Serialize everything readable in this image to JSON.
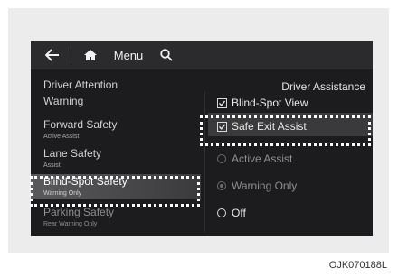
{
  "topbar": {
    "menu_label": "Menu"
  },
  "panel_title": "Driver Assistance",
  "left_menu": [
    {
      "title": "Driver Attention",
      "subtitle": ""
    },
    {
      "title": "Warning",
      "subtitle": ""
    },
    {
      "title": "Forward Safety",
      "subtitle": "Active Assist"
    },
    {
      "title": "Lane Safety",
      "subtitle": "Assist"
    },
    {
      "title": "Blind-Spot Safety",
      "subtitle": "Warning Only"
    },
    {
      "title": "Parking Safety",
      "subtitle": "Rear Warning Only"
    }
  ],
  "right_options": [
    {
      "label": "Blind-Spot View",
      "control": "checkbox",
      "checked": true
    },
    {
      "label": "Safe Exit Assist",
      "control": "checkbox",
      "checked": true
    },
    {
      "label": "Active Assist",
      "control": "radio",
      "selected": false
    },
    {
      "label": "Warning Only",
      "control": "radio",
      "selected": true
    },
    {
      "label": "Off",
      "control": "radio",
      "selected": false
    }
  ],
  "caption": "OJK070188L",
  "colors": {
    "screen_bg": "#1c1c1e",
    "highlight": "#3a3a3c",
    "callout": "#ffffff"
  }
}
